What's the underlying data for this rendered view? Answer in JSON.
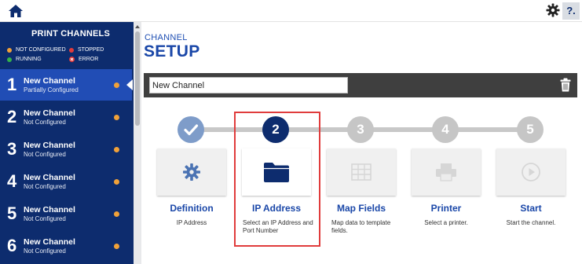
{
  "topbar": {
    "help_label": "?."
  },
  "sidebar": {
    "title": "PRINT CHANNELS",
    "legend": {
      "not_configured": "NOT CONFIGURED",
      "stopped": "STOPPED",
      "running": "RUNNING",
      "error": "ERROR"
    },
    "channels": [
      {
        "number": "1",
        "name": "New Channel",
        "status": "Partially Configured"
      },
      {
        "number": "2",
        "name": "New Channel",
        "status": "Not Configured"
      },
      {
        "number": "3",
        "name": "New Channel",
        "status": "Not Configured"
      },
      {
        "number": "4",
        "name": "New Channel",
        "status": "Not Configured"
      },
      {
        "number": "5",
        "name": "New Channel",
        "status": "Not Configured"
      },
      {
        "number": "6",
        "name": "New Channel",
        "status": "Not Configured"
      }
    ]
  },
  "main": {
    "heading_small": "CHANNEL",
    "heading_big": "SETUP",
    "channel_name_value": "New Channel",
    "steps": [
      {
        "number": "",
        "title": "Definition",
        "description": "IP Address"
      },
      {
        "number": "2",
        "title": "IP Address",
        "description": "Select an IP Address and Port Number"
      },
      {
        "number": "3",
        "title": "Map Fields",
        "description": "Map data to template fields."
      },
      {
        "number": "4",
        "title": "Printer",
        "description": "Select a printer."
      },
      {
        "number": "5",
        "title": "Start",
        "description": "Start the channel."
      }
    ]
  },
  "colors": {
    "navy": "#0d2c6e",
    "active_row": "#214db5",
    "accent_blue": "#1a47a8",
    "step_done": "#7e9cc9",
    "step_active": "#0d2c6e",
    "step_inactive": "#c6c6c6",
    "status_orange": "#f0a139",
    "highlight_red": "#e03c3c"
  }
}
